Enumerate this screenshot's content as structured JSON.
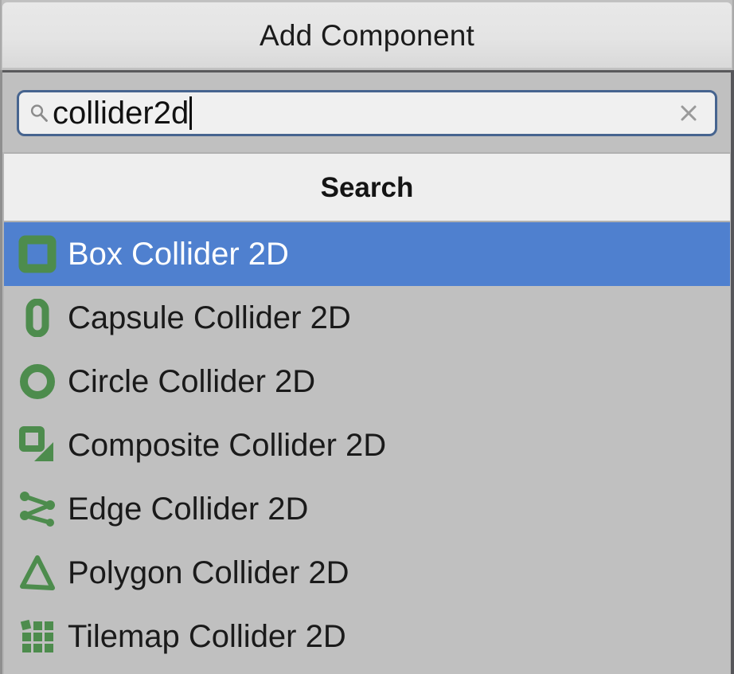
{
  "window": {
    "title": "Add Component"
  },
  "search": {
    "value": "collider2d",
    "placeholder": "Search",
    "magnifier_icon": "search-icon",
    "clear_icon": "close-icon"
  },
  "results": {
    "group_label": "Search",
    "items": [
      {
        "label": "Box Collider 2D",
        "icon": "box-collider-2d-icon",
        "selected": true
      },
      {
        "label": "Capsule Collider 2D",
        "icon": "capsule-collider-2d-icon",
        "selected": false
      },
      {
        "label": "Circle Collider 2D",
        "icon": "circle-collider-2d-icon",
        "selected": false
      },
      {
        "label": "Composite Collider 2D",
        "icon": "composite-collider-2d-icon",
        "selected": false
      },
      {
        "label": "Edge Collider 2D",
        "icon": "edge-collider-2d-icon",
        "selected": false
      },
      {
        "label": "Polygon Collider 2D",
        "icon": "polygon-collider-2d-icon",
        "selected": false
      },
      {
        "label": "Tilemap Collider 2D",
        "icon": "tilemap-collider-2d-icon",
        "selected": false
      }
    ]
  },
  "colors": {
    "selection_blue": "#4f80cf",
    "icon_green": "#4d8c4d",
    "list_background": "#c0c0c0",
    "group_header_background": "#eeeeee",
    "titlebar_background": "#e4e4e4",
    "search_border": "#46648f"
  }
}
